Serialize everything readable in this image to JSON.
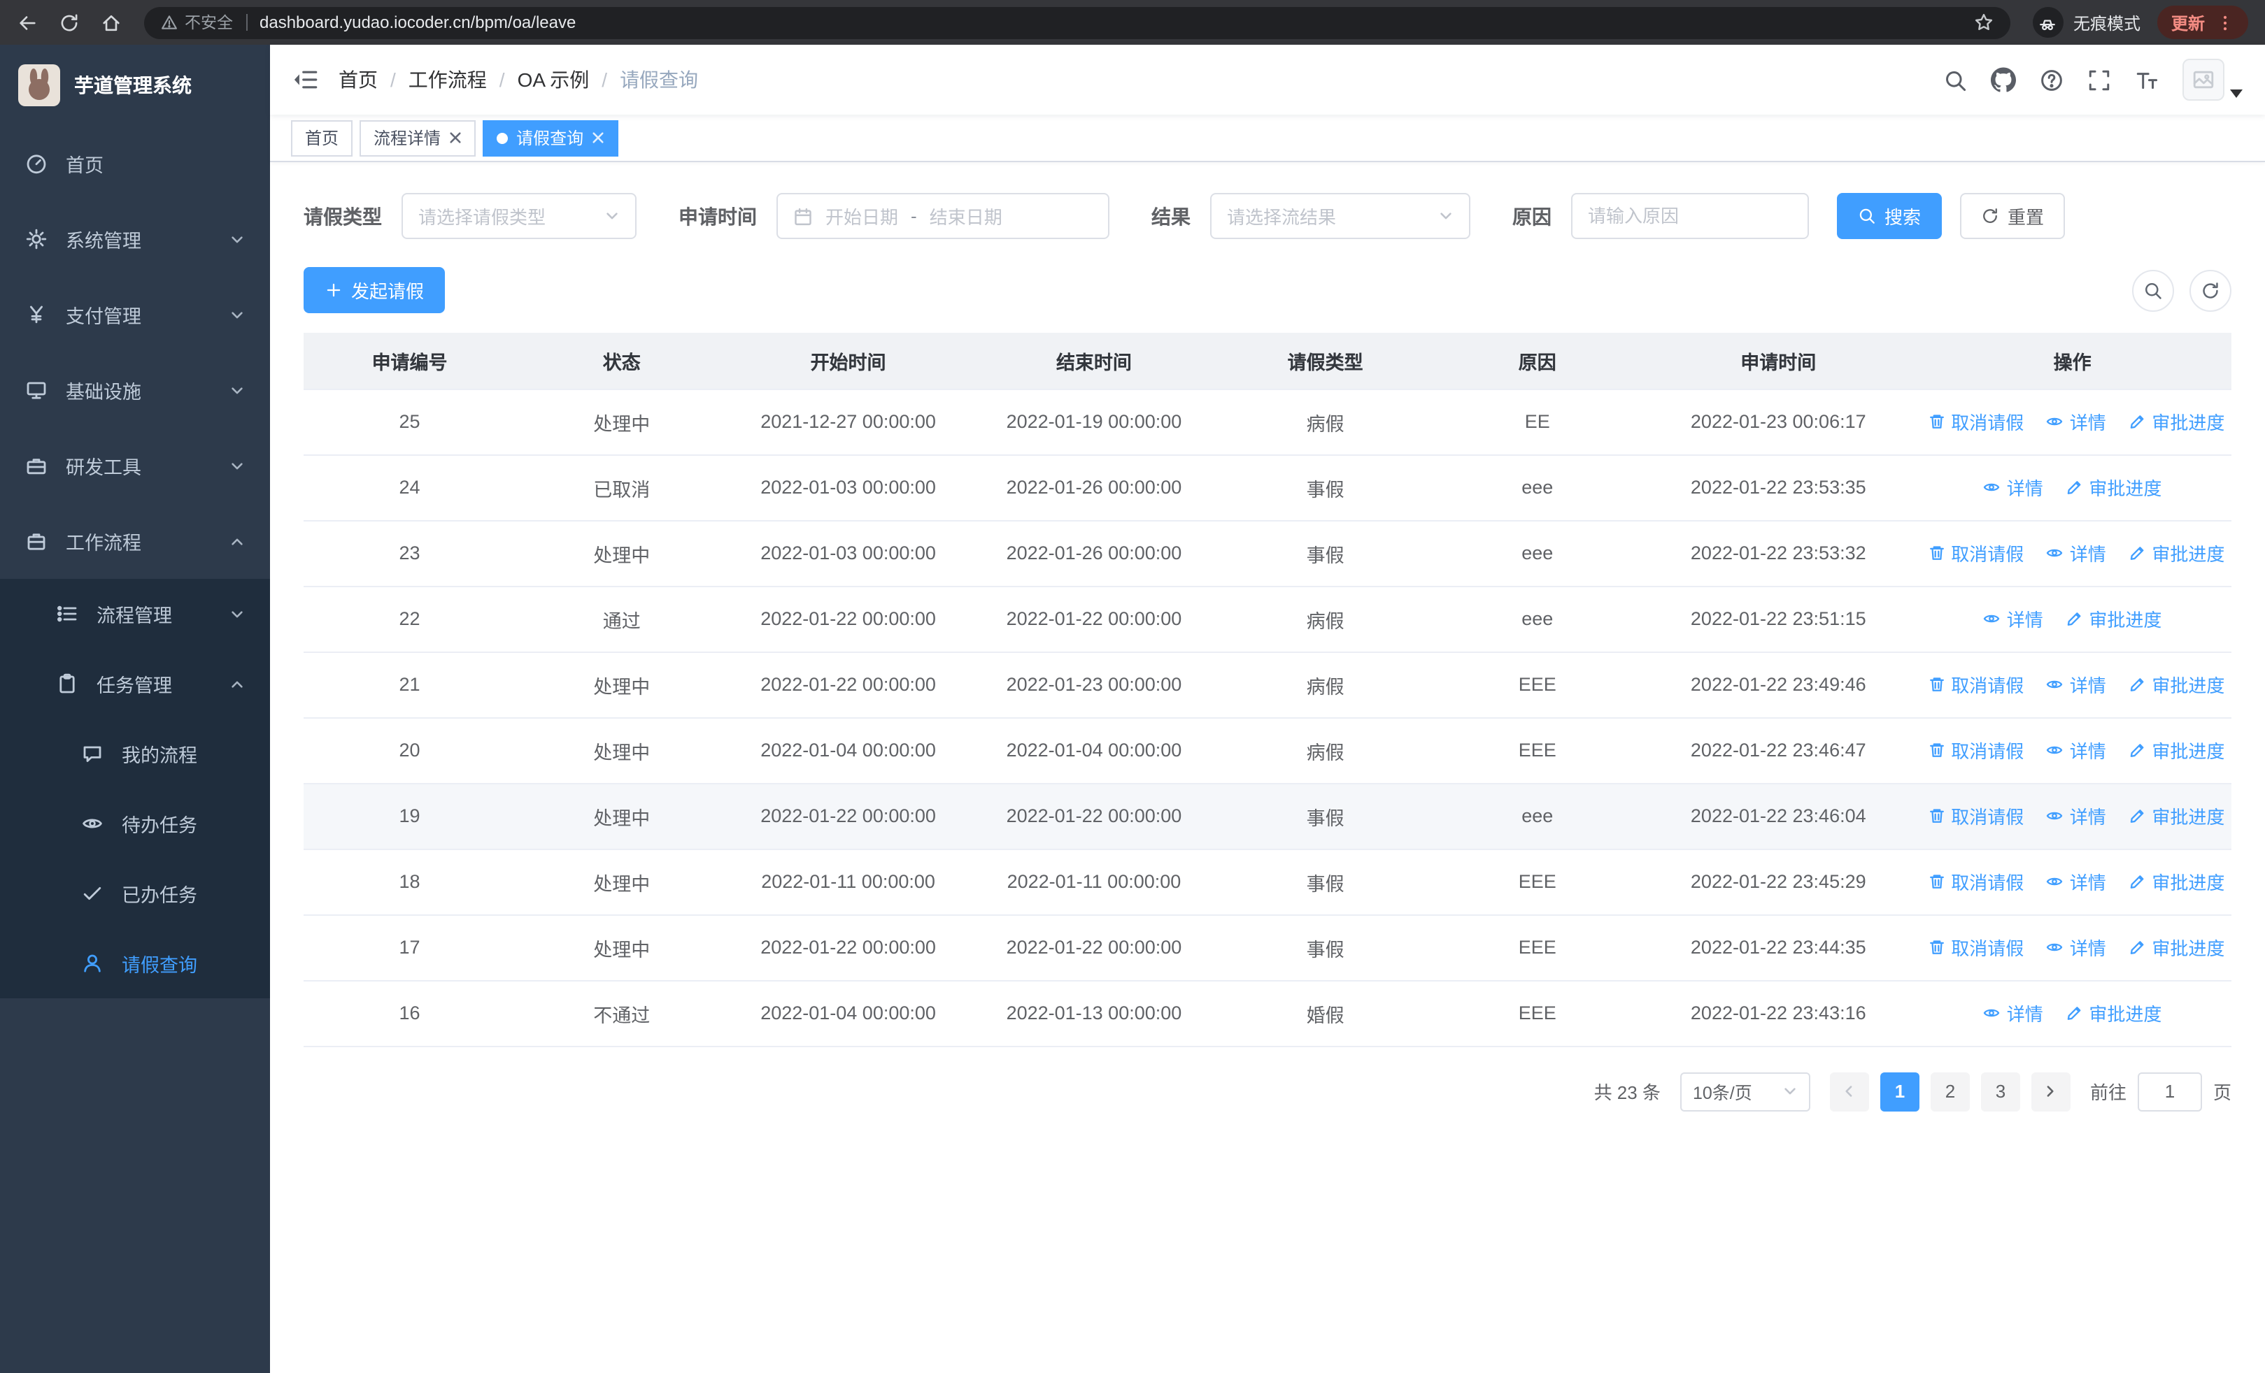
{
  "browser": {
    "security_warning": "不安全",
    "url": "dashboard.yudao.iocoder.cn/bpm/oa/leave",
    "incognito_label": "无痕模式",
    "update_label": "更新"
  },
  "sidebar": {
    "logo_title": "芋道管理系统",
    "items": [
      {
        "label": "首页"
      },
      {
        "label": "系统管理"
      },
      {
        "label": "支付管理"
      },
      {
        "label": "基础设施"
      },
      {
        "label": "研发工具"
      },
      {
        "label": "工作流程"
      }
    ],
    "workflow_children": [
      {
        "label": "流程管理"
      },
      {
        "label": "任务管理"
      }
    ],
    "task_children": [
      {
        "label": "我的流程"
      },
      {
        "label": "待办任务"
      },
      {
        "label": "已办任务"
      },
      {
        "label": "请假查询"
      }
    ]
  },
  "header": {
    "breadcrumb": [
      "首页",
      "工作流程",
      "OA 示例",
      "请假查询"
    ]
  },
  "tabs": [
    {
      "label": "首页"
    },
    {
      "label": "流程详情"
    },
    {
      "label": "请假查询"
    }
  ],
  "filters": {
    "leave_type": {
      "label": "请假类型",
      "placeholder": "请选择请假类型"
    },
    "apply_time": {
      "label": "申请时间",
      "start_placeholder": "开始日期",
      "separator": "-",
      "end_placeholder": "结束日期"
    },
    "result": {
      "label": "结果",
      "placeholder": "请选择流结果"
    },
    "reason": {
      "label": "原因",
      "placeholder": "请输入原因"
    },
    "search_button": "搜索",
    "reset_button": "重置"
  },
  "toolbar": {
    "create_button": "发起请假"
  },
  "table": {
    "columns": [
      "申请编号",
      "状态",
      "开始时间",
      "结束时间",
      "请假类型",
      "原因",
      "申请时间",
      "操作"
    ],
    "actions": {
      "cancel": "取消请假",
      "detail": "详情",
      "progress": "审批进度"
    },
    "rows": [
      {
        "id": "25",
        "status": "处理中",
        "start": "2021-12-27 00:00:00",
        "end": "2022-01-19 00:00:00",
        "type": "病假",
        "reason": "EE",
        "applied": "2022-01-23 00:06:17",
        "can_cancel": true
      },
      {
        "id": "24",
        "status": "已取消",
        "start": "2022-01-03 00:00:00",
        "end": "2022-01-26 00:00:00",
        "type": "事假",
        "reason": "eee",
        "applied": "2022-01-22 23:53:35",
        "can_cancel": false
      },
      {
        "id": "23",
        "status": "处理中",
        "start": "2022-01-03 00:00:00",
        "end": "2022-01-26 00:00:00",
        "type": "事假",
        "reason": "eee",
        "applied": "2022-01-22 23:53:32",
        "can_cancel": true
      },
      {
        "id": "22",
        "status": "通过",
        "start": "2022-01-22 00:00:00",
        "end": "2022-01-22 00:00:00",
        "type": "病假",
        "reason": "eee",
        "applied": "2022-01-22 23:51:15",
        "can_cancel": false
      },
      {
        "id": "21",
        "status": "处理中",
        "start": "2022-01-22 00:00:00",
        "end": "2022-01-23 00:00:00",
        "type": "病假",
        "reason": "EEE",
        "applied": "2022-01-22 23:49:46",
        "can_cancel": true
      },
      {
        "id": "20",
        "status": "处理中",
        "start": "2022-01-04 00:00:00",
        "end": "2022-01-04 00:00:00",
        "type": "病假",
        "reason": "EEE",
        "applied": "2022-01-22 23:46:47",
        "can_cancel": true
      },
      {
        "id": "19",
        "status": "处理中",
        "start": "2022-01-22 00:00:00",
        "end": "2022-01-22 00:00:00",
        "type": "事假",
        "reason": "eee",
        "applied": "2022-01-22 23:46:04",
        "can_cancel": true,
        "hover": true
      },
      {
        "id": "18",
        "status": "处理中",
        "start": "2022-01-11 00:00:00",
        "end": "2022-01-11 00:00:00",
        "type": "事假",
        "reason": "EEE",
        "applied": "2022-01-22 23:45:29",
        "can_cancel": true
      },
      {
        "id": "17",
        "status": "处理中",
        "start": "2022-01-22 00:00:00",
        "end": "2022-01-22 00:00:00",
        "type": "事假",
        "reason": "EEE",
        "applied": "2022-01-22 23:44:35",
        "can_cancel": true
      },
      {
        "id": "16",
        "status": "不通过",
        "start": "2022-01-04 00:00:00",
        "end": "2022-01-13 00:00:00",
        "type": "婚假",
        "reason": "EEE",
        "applied": "2022-01-22 23:43:16",
        "can_cancel": false
      }
    ]
  },
  "pagination": {
    "total": "共 23 条",
    "page_size": "10条/页",
    "pages": [
      "1",
      "2",
      "3"
    ],
    "active_page": "1",
    "jump_prefix": "前往",
    "jump_value": "1",
    "jump_suffix": "页"
  },
  "colors": {
    "primary": "#409eff",
    "sidebar_bg": "#2d3a4b",
    "submenu_bg": "#1f2d3d"
  }
}
